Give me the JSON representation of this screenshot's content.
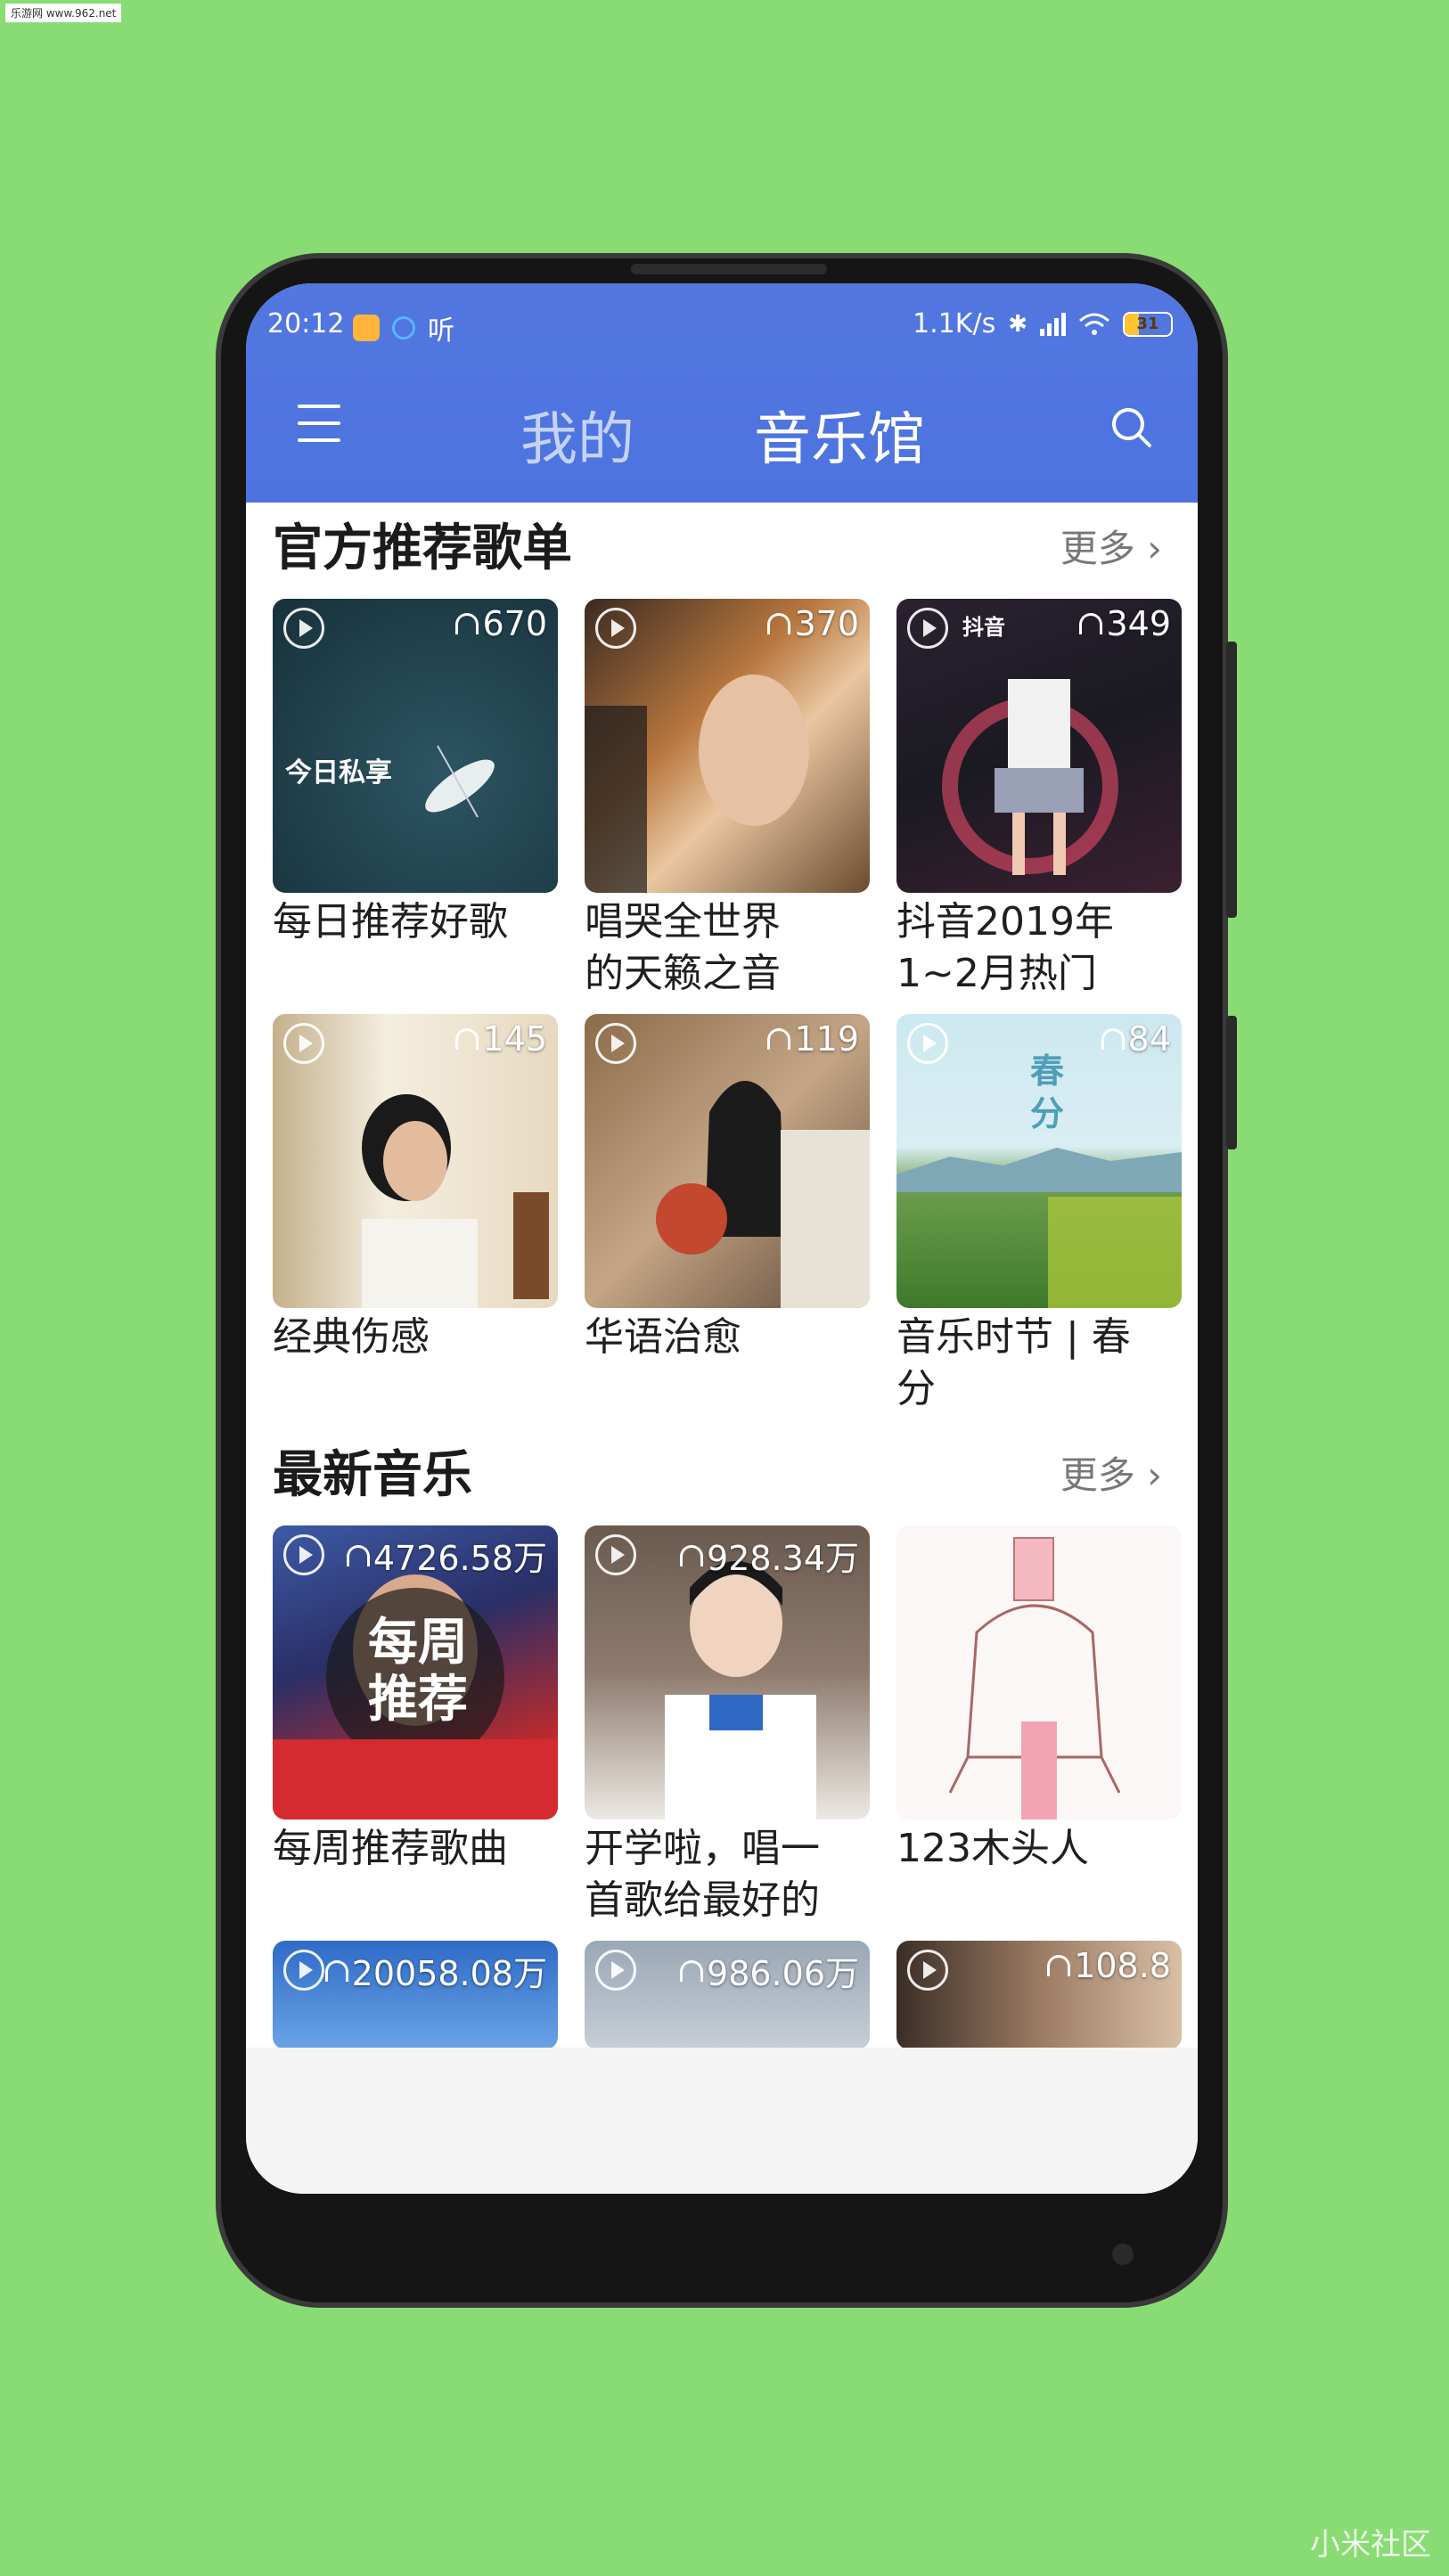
{
  "watermark_top": "乐游网 www.962.net",
  "watermark_bottom": "小米社区",
  "status": {
    "time": "20:12",
    "ting": "听",
    "speed": "1.1K/s",
    "battery": "31"
  },
  "tabs": [
    {
      "label": "我的"
    },
    {
      "label": "音乐馆"
    }
  ],
  "sections": [
    {
      "title": "官方推荐歌单",
      "more": "更多",
      "items": [
        {
          "title": "每日推荐好歌",
          "count": "670",
          "overlay": "今日私享"
        },
        {
          "title": "唱哭全世界的天籁之音",
          "count": "370"
        },
        {
          "title": "抖音2019年1~2月热门",
          "count": "349",
          "overlay": "抖音"
        },
        {
          "title": "经典伤感",
          "count": "145"
        },
        {
          "title": "华语治愈",
          "count": "119"
        },
        {
          "title": "音乐时节 | 春分",
          "count": "84",
          "overlay": "春分"
        }
      ]
    },
    {
      "title": "最新音乐",
      "more": "更多",
      "items": [
        {
          "title": "每周推荐歌曲",
          "count": "4726.58万",
          "overlay": "每周推荐"
        },
        {
          "title": "开学啦，唱一首歌给最好的",
          "count": "928.34万"
        },
        {
          "title": "123木头人",
          "count": ""
        },
        {
          "title": "",
          "count": "20058.08万"
        },
        {
          "title": "",
          "count": "986.06万"
        },
        {
          "title": "",
          "count": "108.8"
        }
      ]
    }
  ]
}
